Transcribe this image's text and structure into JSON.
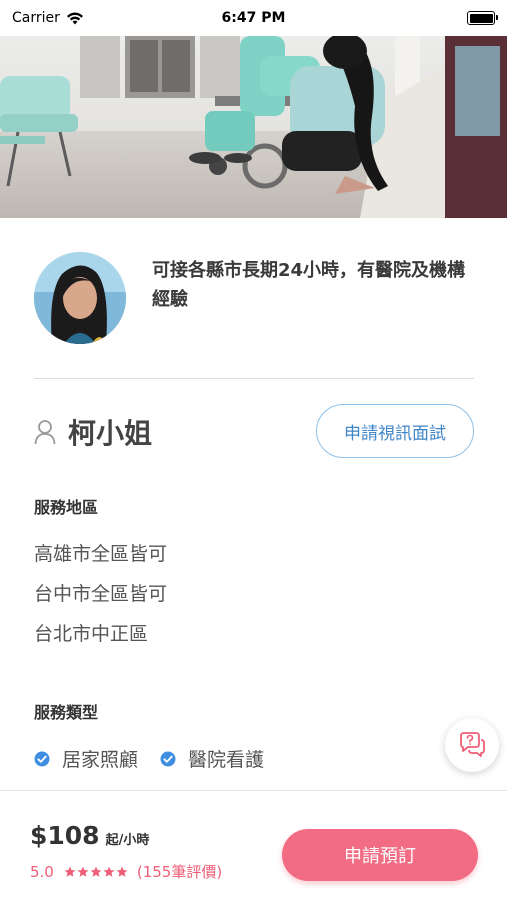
{
  "status_bar": {
    "carrier": "Carrier",
    "time": "6:47 PM"
  },
  "profile": {
    "intro": "可接各縣市長期24小時，有醫院及機構經驗",
    "name": "柯小姐",
    "video_interview_label": "申請視訊面試"
  },
  "service_area": {
    "title": "服務地區",
    "items": [
      "高雄市全區皆可",
      "台中市全區皆可",
      "台北市中正區"
    ]
  },
  "service_type": {
    "title": "服務類型",
    "items": [
      "居家照顧",
      "醫院看護"
    ]
  },
  "booking": {
    "price": "$108",
    "price_unit": "起/小時",
    "rating_value": "5.0",
    "stars": 5,
    "review_count": "(155筆評價)",
    "book_label": "申請預訂"
  },
  "colors": {
    "accent_blue": "#3f86c9",
    "accent_pink": "#f26d84",
    "check_blue": "#3f8fe0"
  }
}
